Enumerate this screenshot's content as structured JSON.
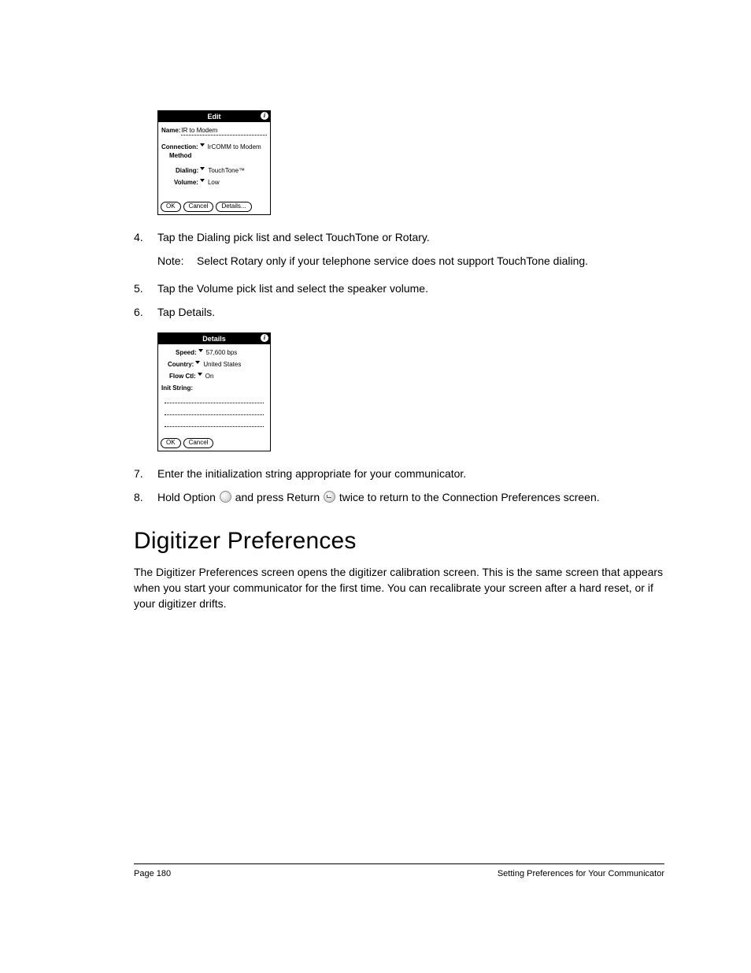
{
  "edit_dialog": {
    "title": "Edit",
    "info_glyph": "i",
    "name_label": "Name:",
    "name_value": "IR to Modem",
    "connection_label": "Connection:",
    "connection_value": "IrCOMM to Modem",
    "method_label": "Method",
    "dialing_label": "Dialing:",
    "dialing_value": "TouchTone™",
    "volume_label": "Volume:",
    "volume_value": "Low",
    "ok": "OK",
    "cancel": "Cancel",
    "details": "Details..."
  },
  "steps_a": {
    "s4_num": "4.",
    "s4": "Tap the Dialing pick list and select TouchTone or Rotary.",
    "note_label": "Note:",
    "note": "Select Rotary only if your telephone service does not support TouchTone dialing.",
    "s5_num": "5.",
    "s5": "Tap the Volume pick list and select the speaker volume.",
    "s6_num": "6.",
    "s6": "Tap Details."
  },
  "details_dialog": {
    "title": "Details",
    "info_glyph": "i",
    "speed_label": "Speed:",
    "speed_value": "57,600 bps",
    "country_label": "Country:",
    "country_value": "United States",
    "flow_label": "Flow Ctl:",
    "flow_value": "On",
    "init_label": "Init String:",
    "ok": "OK",
    "cancel": "Cancel"
  },
  "steps_b": {
    "s7_num": "7.",
    "s7": "Enter the initialization string appropriate for your communicator.",
    "s8_num": "8.",
    "s8_a": "Hold Option ",
    "s8_b": " and press Return ",
    "s8_c": " twice to return to the Connection Preferences screen."
  },
  "heading": "Digitizer Preferences",
  "body_para": "The Digitizer Preferences screen opens the digitizer calibration screen. This is the same screen that appears when you start your communicator for the first time. You can recalibrate your screen after a hard reset, or if your digitizer drifts.",
  "footer": {
    "left": "Page 180",
    "right": "Setting Preferences for Your Communicator"
  }
}
